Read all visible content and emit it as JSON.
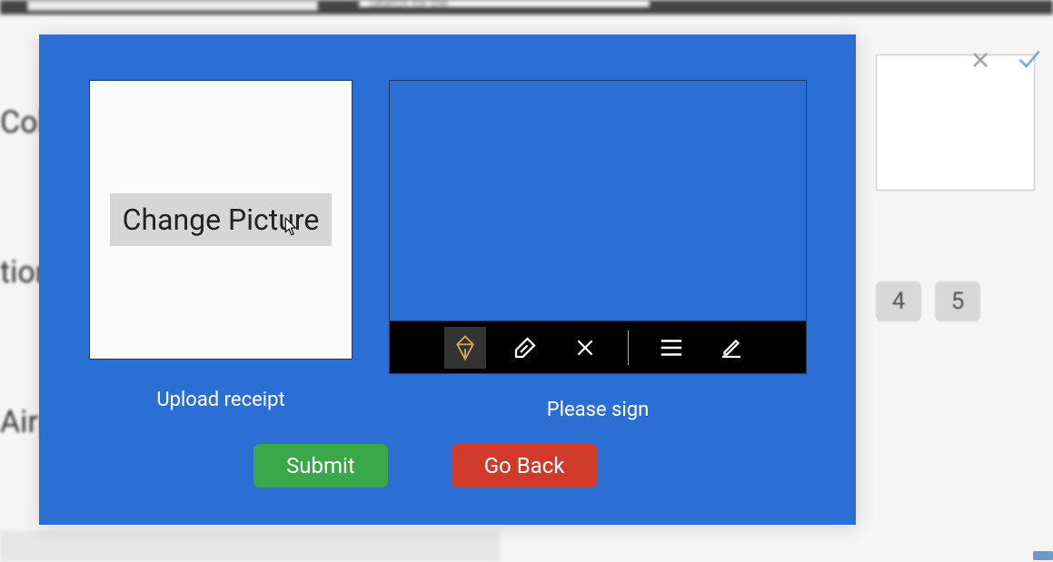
{
  "background": {
    "search_placeholder": "Search for the",
    "text_fragments": {
      "coke": "Cok",
      "tion": "tion",
      "airp": "Airp"
    },
    "number_boxes": [
      "4",
      "5"
    ]
  },
  "modal": {
    "upload": {
      "button_label": "Change Picture",
      "caption": "Upload receipt"
    },
    "signature": {
      "caption": "Please sign",
      "tools": {
        "pen": "pen-icon",
        "eraser": "eraser-icon",
        "clear": "clear-icon",
        "lines": "lines-icon",
        "edit": "edit-icon"
      }
    },
    "buttons": {
      "submit": "Submit",
      "goback": "Go Back"
    }
  }
}
